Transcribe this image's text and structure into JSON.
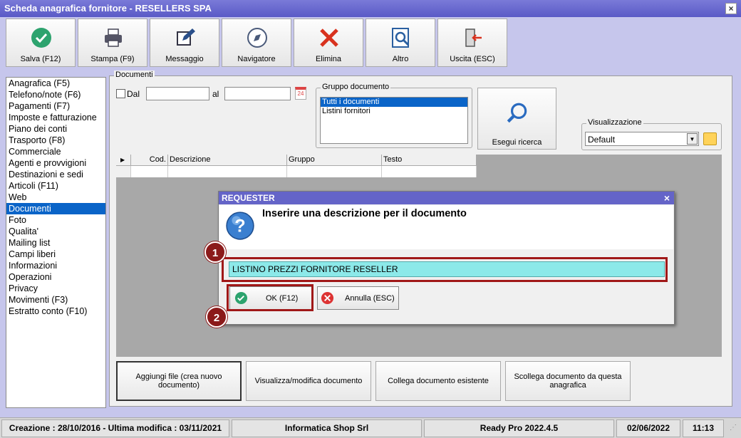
{
  "window": {
    "title": "Scheda anagrafica fornitore - RESELLERS SPA",
    "close": "×"
  },
  "toolbar": [
    {
      "label": "Salva (F12)",
      "icon": "check-circle-icon"
    },
    {
      "label": "Stampa (F9)",
      "icon": "printer-icon"
    },
    {
      "label": "Messaggio",
      "icon": "compose-icon"
    },
    {
      "label": "Navigatore",
      "icon": "compass-icon"
    },
    {
      "label": "Elimina",
      "icon": "red-x-icon"
    },
    {
      "label": "Altro",
      "icon": "search-doc-icon"
    },
    {
      "label": "Uscita (ESC)",
      "icon": "exit-door-icon"
    }
  ],
  "sidebar": {
    "items": [
      "Anagrafica (F5)",
      "Telefono/note (F6)",
      "Pagamenti (F7)",
      "Imposte e fatturazione",
      "Piano dei conti",
      "Trasporto (F8)",
      "Commerciale",
      "Agenti e provvigioni",
      "Destinazioni e sedi",
      "Articoli (F11)",
      "Web",
      "Documenti",
      "Foto",
      "Qualita'",
      "Mailing list",
      "Campi liberi",
      "Informazioni",
      "Operazioni",
      "Privacy",
      "Movimenti (F3)",
      "Estratto conto (F10)"
    ],
    "selected": "Documenti"
  },
  "documenti": {
    "legend": "Documenti",
    "dal_label": "Dal",
    "al_label": "al",
    "calendar_text": "24",
    "gruppo_legend": "Gruppo documento",
    "gruppo_items": [
      "Tutti i documenti",
      "Listini fornitori"
    ],
    "search_label": "Esegui ricerca",
    "vis_legend": "Visualizzazione",
    "vis_value": "Default",
    "columns": [
      "Cod.",
      "Descrizione",
      "Gruppo",
      "Testo"
    ]
  },
  "bottom_buttons": [
    "Aggiungi file (crea nuovo documento)",
    "Visualizza/modifica documento",
    "Collega documento esistente",
    "Scollega documento da questa anagrafica"
  ],
  "dialog": {
    "title": "REQUESTER",
    "close": "×",
    "message": "Inserire una descrizione per il documento",
    "value": "LISTINO PREZZI FORNITORE RESELLER",
    "ok_label": "OK (F12)",
    "cancel_label": "Annulla (ESC)"
  },
  "badges": [
    "1",
    "2"
  ],
  "status": {
    "dates": "Creazione : 28/10/2016 - Ultima modifica : 03/11/2021",
    "company": "Informatica Shop Srl",
    "version": "Ready Pro 2022.4.5",
    "date": "02/06/2022",
    "time": "11:13"
  }
}
